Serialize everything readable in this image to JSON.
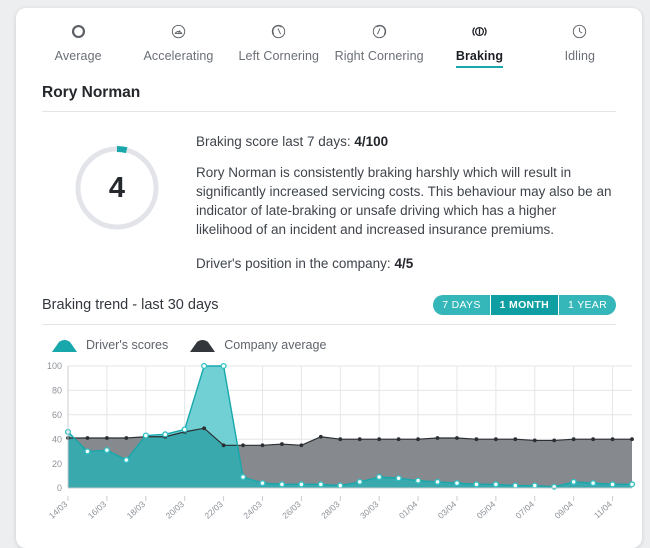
{
  "colors": {
    "teal": "#18a7ab",
    "teal_fill": "#3aacb0",
    "teal_light": "#5fc9cd",
    "gray_fill": "#7c8085",
    "gray_line": "#2b2e33",
    "track": "#e2e4ea",
    "accent_bar": "#18a7ab",
    "segment_bg": "#35b6b9",
    "segment_active": "#0f9ea2"
  },
  "tabs": [
    {
      "label": "Average",
      "icon": "ring-icon",
      "active": false
    },
    {
      "label": "Accelerating",
      "icon": "accelerating-gauge-icon",
      "active": false
    },
    {
      "label": "Left Cornering",
      "icon": "left-cornering-icon",
      "active": false
    },
    {
      "label": "Right Cornering",
      "icon": "right-cornering-icon",
      "active": false
    },
    {
      "label": "Braking",
      "icon": "braking-disc-icon",
      "active": true
    },
    {
      "label": "Idling",
      "icon": "clock-icon",
      "active": false
    }
  ],
  "driver": {
    "name": "Rory Norman"
  },
  "summary": {
    "gauge_value": "4",
    "gauge_percent": 4,
    "score_label": "Braking score last 7 days:",
    "score_value": "4/100",
    "description": "Rory Norman is consistently braking harshly which will result in significantly increased servicing costs. This behaviour may also be an indicator of late-braking or unsafe driving which has a higher likelihood of an incident and increased insurance premiums.",
    "position_label": "Driver's position in the company:",
    "position_value": "4/5"
  },
  "trend": {
    "title": "Braking trend - last 30 days",
    "ranges": [
      {
        "label": "7 DAYS",
        "active": false
      },
      {
        "label": "1 MONTH",
        "active": true
      },
      {
        "label": "1 YEAR",
        "active": false
      }
    ],
    "legend": [
      {
        "label": "Driver's scores",
        "swatch": "teal-area-swatch"
      },
      {
        "label": "Company average",
        "swatch": "gray-area-swatch"
      }
    ]
  },
  "chart_data": {
    "type": "area",
    "title": "Braking trend - last 30 days",
    "xlabel": "",
    "ylabel": "",
    "ylim": [
      0,
      100
    ],
    "yticks": [
      0,
      20,
      40,
      60,
      80,
      100
    ],
    "grid": true,
    "legend_position": "top-left",
    "x": [
      "14/03",
      "15/03",
      "16/03",
      "17/03",
      "18/03",
      "19/03",
      "20/03",
      "21/03",
      "22/03",
      "23/03",
      "24/03",
      "25/03",
      "26/03",
      "27/03",
      "28/03",
      "29/03",
      "30/03",
      "31/03",
      "01/04",
      "02/04",
      "03/04",
      "04/04",
      "05/04",
      "06/04",
      "07/04",
      "08/04",
      "09/04",
      "10/04",
      "11/04",
      "12/04"
    ],
    "xtick_labels": [
      "14/03",
      "16/03",
      "18/03",
      "20/03",
      "22/03",
      "24/03",
      "26/03",
      "28/03",
      "30/03",
      "01/04",
      "03/04",
      "05/04",
      "07/04",
      "09/04",
      "11/04"
    ],
    "series": [
      {
        "name": "Driver's scores",
        "color": "#18a7ab",
        "values": [
          46,
          30,
          31,
          23,
          43,
          44,
          48,
          100,
          100,
          9,
          4,
          3,
          3,
          3,
          2,
          5,
          9,
          8,
          6,
          5,
          4,
          3,
          3,
          2,
          2,
          1,
          5,
          4,
          3,
          3
        ]
      },
      {
        "name": "Company average",
        "color": "#2b2e33",
        "values": [
          41,
          41,
          41,
          41,
          42,
          42,
          46,
          49,
          35,
          35,
          35,
          36,
          35,
          42,
          40,
          40,
          40,
          40,
          40,
          41,
          41,
          40,
          40,
          40,
          39,
          39,
          40,
          40,
          40,
          40
        ]
      }
    ]
  }
}
